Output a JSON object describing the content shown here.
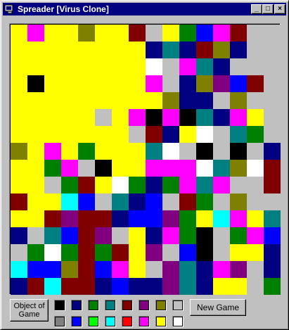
{
  "window": {
    "title": "Spreader [Virus Clone]"
  },
  "title_buttons": {
    "minimize": "_",
    "maximize": "□",
    "close": "×"
  },
  "controls": {
    "object_button_label": "Object of\nGame",
    "new_game_label": "New Game"
  },
  "palette": [
    "#000000",
    "#000080",
    "#008000",
    "#008080",
    "#800000",
    "#800080",
    "#808000",
    "#c0c0c0",
    "#808080",
    "#0000ff",
    "#00ff00",
    "#00ffff",
    "#ff0000",
    "#ff00ff",
    "#ffff00",
    "#ffffff"
  ],
  "board": {
    "size": 16,
    "rows": [
      "YMYYOYYRSYGBMRS",
      "YYYYYYYYNTNRON",
      "YYYYYYYYWSMTNSS",
      "YKYYYYYYMSNOPBR",
      "YYYYYYYYYONNSO",
      "YYYYYSYMKMKTNMY",
      "YYYYYYYSRNYWSTGS",
      "OYMYGYYYTWSKSKSN",
      "YYGMSKYYMMMWTOWR",
      "YYSGRYWGNGMTMSSR",
      "RYYCBSTNBSRGSOS",
      "YYRPRRNBBPGYCMYT",
      "NSTBRPSYNMGKSGMB",
      "SGWGRGRYPSBKSYYN",
      "CBBORBMYSPTNMPSN",
      "NRCRRNBNNPTNYYSG"
    ]
  }
}
